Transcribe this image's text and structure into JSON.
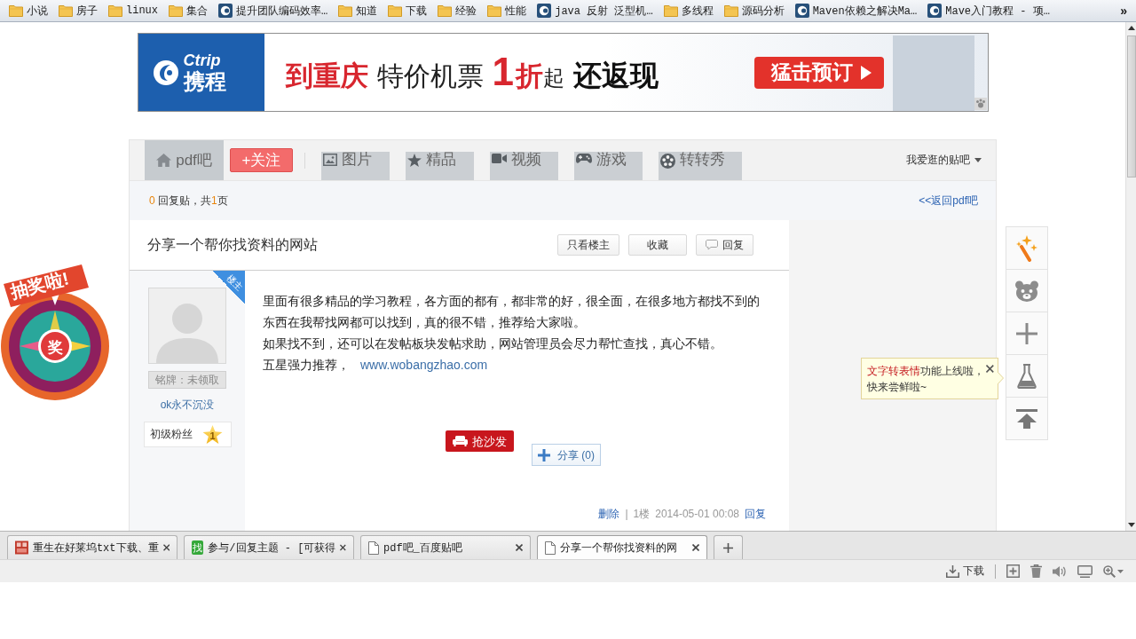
{
  "bookmarks_bar": {
    "items": [
      {
        "label": "小说",
        "kind": "folder"
      },
      {
        "label": "房子",
        "kind": "folder"
      },
      {
        "label": "linux",
        "kind": "folder"
      },
      {
        "label": "集合",
        "kind": "folder"
      },
      {
        "label": "提升团队编码效率…",
        "kind": "page"
      },
      {
        "label": "知道",
        "kind": "folder"
      },
      {
        "label": "下载",
        "kind": "folder"
      },
      {
        "label": "经验",
        "kind": "folder"
      },
      {
        "label": "性能",
        "kind": "folder"
      },
      {
        "label": "java 反射 泛型机…",
        "kind": "page"
      },
      {
        "label": "多线程",
        "kind": "folder"
      },
      {
        "label": "源码分析",
        "kind": "folder"
      },
      {
        "label": "Maven依赖之解决Ma…",
        "kind": "page"
      },
      {
        "label": "Mave入门教程 - 项…",
        "kind": "page"
      }
    ],
    "overflow": "»"
  },
  "ad_banner": {
    "logo_latin": "Ctrip",
    "logo_cjk": "携程",
    "headline": [
      {
        "parts": [
          {
            "text": "到重庆",
            "kind": "accent"
          }
        ]
      },
      {
        "parts": [
          {
            "text": "特价机票",
            "kind": "plain"
          }
        ]
      },
      {
        "parts": [
          {
            "text": "1",
            "kind": "big-accent"
          },
          {
            "text": "折",
            "kind": "accent"
          },
          {
            "text": "起",
            "kind": "small"
          }
        ]
      },
      {
        "parts": [
          {
            "text": "还返现",
            "kind": "bold"
          }
        ]
      }
    ],
    "button": "猛击预订"
  },
  "forum_nav": {
    "tabs": [
      {
        "label": "pdf吧",
        "selected": true
      },
      {
        "label": "图片",
        "selected": false
      },
      {
        "label": "精品",
        "selected": false
      },
      {
        "label": "视频",
        "selected": false
      },
      {
        "label": "游戏",
        "selected": false
      },
      {
        "label": "转转秀",
        "selected": false
      }
    ],
    "follow_button": "+关注",
    "my_forums": "我爱逛的贴吧"
  },
  "thread_summary": {
    "reply_count": "0",
    "reply_text": "回复贴，共",
    "page_count": "1",
    "page_text": "页",
    "back_link": "<<返回pdf吧"
  },
  "post": {
    "title": "分享一个帮你找资料的网站",
    "actions": [
      {
        "label": "只看楼主",
        "kind": "text"
      },
      {
        "label": "收藏",
        "kind": "text"
      },
      {
        "label": "回复",
        "kind": "comment"
      }
    ],
    "author": {
      "ribbon": "楼主",
      "nameplate": "铭牌：未领取",
      "name": "ok永不沉没",
      "rank": "初级粉丝",
      "rank_level": "1"
    },
    "paragraphs": [
      "里面有很多精品的学习教程，各方面的都有，都非常的好，很全面，在很多地方都找不到的东西在我帮找网都可以找到，真的很不错，推荐给大家啦。",
      "如果找不到，还可以在发帖板块发帖求助，网站管理员会尽力帮忙查找，真心不错。"
    ],
    "recommend_text": "五星强力推荐，",
    "link": "www.wobangzhao.com",
    "sofa_button": "抢沙发",
    "share_button": "分享 (0)",
    "footer": {
      "delete": "删除",
      "separator": "|",
      "floor": "1楼",
      "time": "2014-05-01 00:08",
      "reply": "回复"
    }
  },
  "side_toolbar": {
    "tooltip": {
      "highlight": "文字转表情",
      "text": "功能上线啦，快来尝鲜啦~"
    }
  },
  "lottery": {
    "banner": "抽奖啦!",
    "prize": "奖"
  },
  "browser_tabs": [
    {
      "title": "重生在好莱坞txt下载、重",
      "kind": "image",
      "selected": false
    },
    {
      "title": "参与/回复主题 - [可获得",
      "kind": "badge",
      "badge": "找",
      "selected": false
    },
    {
      "title": "pdf吧_百度贴吧",
      "kind": "page",
      "selected": false
    },
    {
      "title": "分享一个帮你找资料的网",
      "kind": "page",
      "selected": true
    }
  ],
  "status_bar": {
    "download": "下载"
  }
}
